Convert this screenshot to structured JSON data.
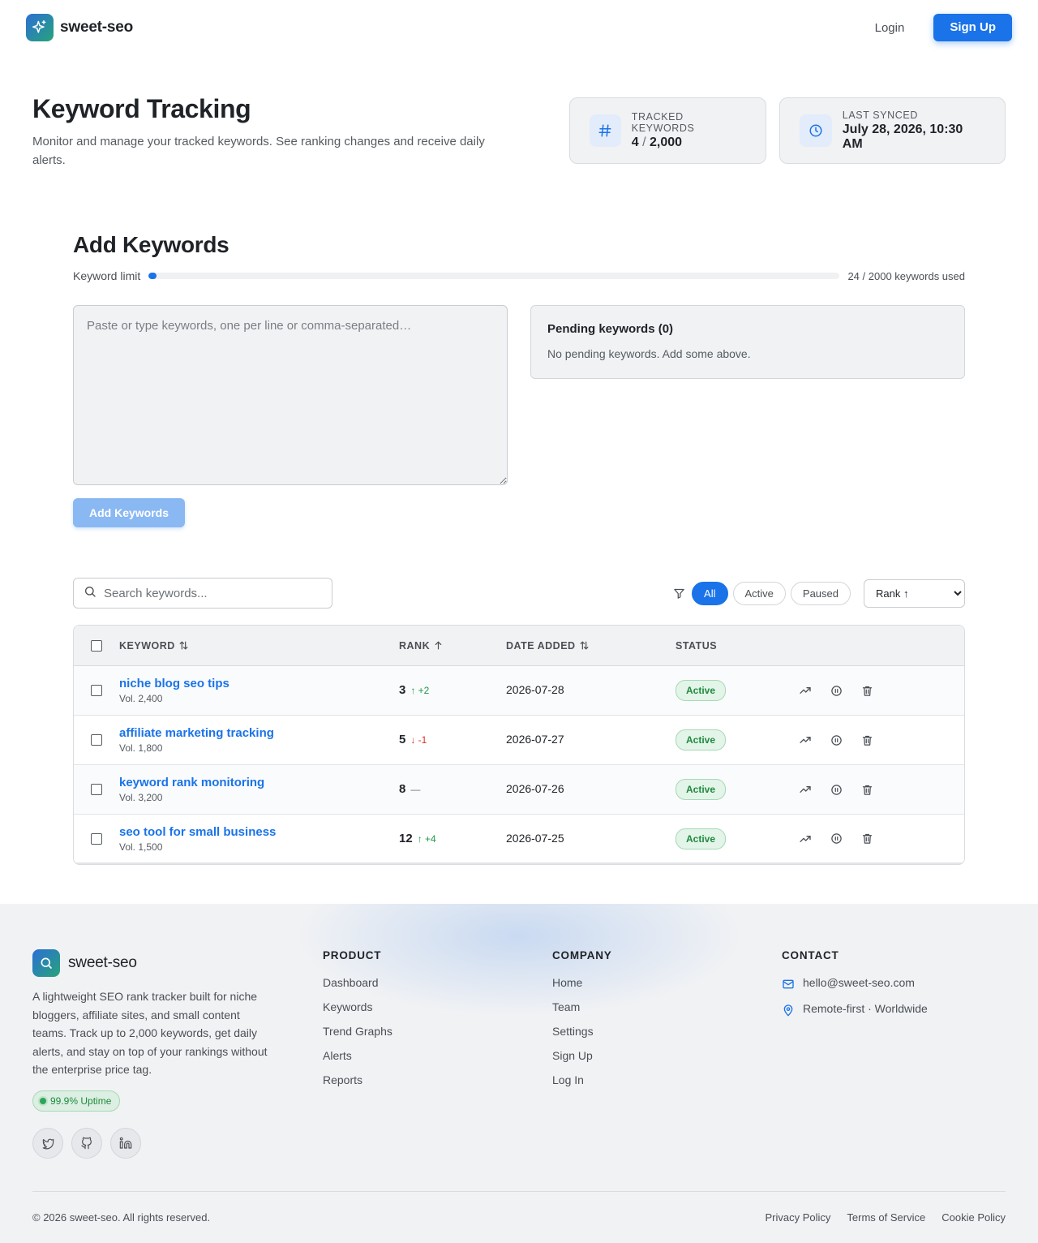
{
  "header": {
    "brand": "sweet-seo",
    "login_label": "Login",
    "signup_label": "Sign Up"
  },
  "hero": {
    "title": "Keyword Tracking",
    "subtitle": "Monitor and manage your tracked keywords. See ranking changes and receive daily alerts.",
    "stats": {
      "tracked_label": "Tracked Keywords",
      "tracked_value": "4",
      "tracked_separator": "/",
      "tracked_max": "2,000",
      "synced_label": "Last Synced",
      "synced_value": "July 28, 2026, 10:30 AM"
    }
  },
  "add_keywords": {
    "title": "Add Keywords",
    "limit_label": "Keyword limit",
    "limit_used": 24,
    "limit_max": 2000,
    "limit_text": "24 / 2000 keywords used",
    "textarea_placeholder": "Paste or type keywords, one per line or comma-separated…",
    "pending_title": "Pending keywords (0)",
    "pending_empty": "No pending keywords. Add some above.",
    "button_label": "Add Keywords"
  },
  "toolbar": {
    "search_placeholder": "Search keywords...",
    "filters": [
      "All",
      "Active",
      "Paused"
    ],
    "active_filter": "All",
    "sort_options": [
      "Rank ↑"
    ],
    "sort_selected": "Rank ↑"
  },
  "table": {
    "columns": {
      "keyword": "KEYWORD",
      "rank": "RANK",
      "date_added": "DATE ADDED",
      "status": "STATUS"
    },
    "rows": [
      {
        "keyword": "niche blog seo tips",
        "volume": "Vol. 2,400",
        "rank": "3",
        "delta": "↑ +2",
        "trend": "up",
        "date": "2026-07-28",
        "status": "Active"
      },
      {
        "keyword": "affiliate marketing tracking",
        "volume": "Vol. 1,800",
        "rank": "5",
        "delta": "↓ -1",
        "trend": "down",
        "date": "2026-07-27",
        "status": "Active"
      },
      {
        "keyword": "keyword rank monitoring",
        "volume": "Vol. 3,200",
        "rank": "8",
        "delta": "—",
        "trend": "flat",
        "date": "2026-07-26",
        "status": "Active"
      },
      {
        "keyword": "seo tool for small business",
        "volume": "Vol. 1,500",
        "rank": "12",
        "delta": "↑ +4",
        "trend": "up",
        "date": "2026-07-25",
        "status": "Active"
      }
    ]
  },
  "footer": {
    "brand": "sweet-seo",
    "description": "A lightweight SEO rank tracker built for niche bloggers, affiliate sites, and small content teams. Track up to 2,000 keywords, get daily alerts, and stay on top of your rankings without the enterprise price tag.",
    "uptime": "99.9% Uptime",
    "socials": [
      "twitter-icon",
      "github-icon",
      "linkedin-icon"
    ],
    "product": {
      "title": "PRODUCT",
      "links": [
        "Dashboard",
        "Keywords",
        "Trend Graphs",
        "Alerts",
        "Reports"
      ]
    },
    "company": {
      "title": "COMPANY",
      "links": [
        "Home",
        "Team",
        "Settings",
        "Sign Up",
        "Log In"
      ]
    },
    "contact": {
      "title": "CONTACT",
      "email": "hello@sweet-seo.com",
      "location": "Remote-first · Worldwide"
    },
    "copyright": "© 2026 sweet-seo. All rights reserved.",
    "legal": [
      "Privacy Policy",
      "Terms of Service",
      "Cookie Policy"
    ]
  },
  "colors": {
    "accent": "#1a73e8",
    "success": "#1e8a3e",
    "danger": "#d93025"
  }
}
